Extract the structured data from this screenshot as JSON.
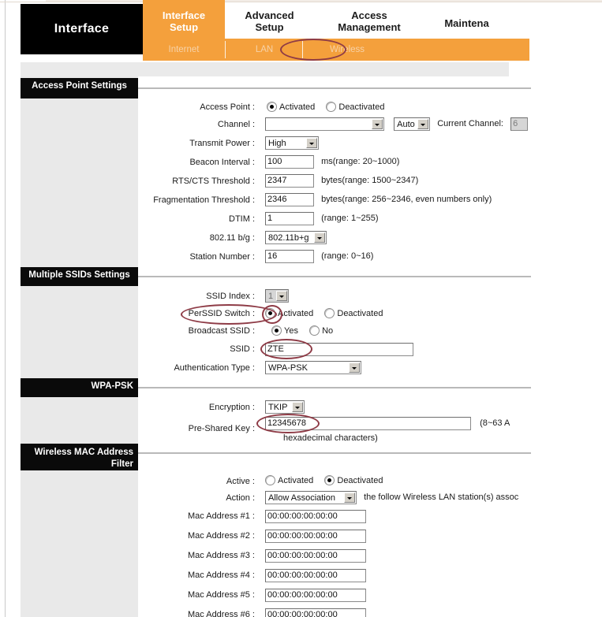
{
  "header": {
    "brand": "Interface",
    "tabs": [
      {
        "name": "interface-setup",
        "line1": "Interface",
        "line2": "Setup",
        "active": true
      },
      {
        "name": "advanced-setup",
        "line1": "Advanced",
        "line2": "Setup",
        "active": false
      },
      {
        "name": "access-management",
        "line1": "Access",
        "line2": "Management",
        "active": false
      },
      {
        "name": "maintenance",
        "line1": "Maintena",
        "line2": "",
        "active": false
      }
    ],
    "subtabs": [
      {
        "name": "internet",
        "label": "Internet"
      },
      {
        "name": "lan",
        "label": "LAN"
      },
      {
        "name": "wireless",
        "label": "Wireless",
        "highlighted": true
      }
    ]
  },
  "sections": {
    "access_point": {
      "title": "Access Point Settings",
      "access_point_label": "Access Point :",
      "access_point_value": "Activated",
      "radio_activated": "Activated",
      "radio_deactivated": "Deactivated",
      "channel_label": "Channel :",
      "channel_value": "",
      "channel_mode": "Auto",
      "current_channel_label": "Current Channel:",
      "current_channel_value": "6",
      "transmit_power_label": "Transmit Power :",
      "transmit_power_value": "High",
      "beacon_interval_label": "Beacon Interval :",
      "beacon_interval_value": "100",
      "beacon_interval_hint": "ms(range: 20~1000)",
      "rts_cts_label": "RTS/CTS Threshold :",
      "rts_cts_value": "2347",
      "rts_cts_hint": "bytes(range: 1500~2347)",
      "fragmentation_label": "Fragmentation Threshold :",
      "fragmentation_value": "2346",
      "fragmentation_hint": "bytes(range: 256~2346, even numbers only)",
      "dtim_label": "DTIM :",
      "dtim_value": "1",
      "dtim_hint": "(range: 1~255)",
      "mode_label": "802.11 b/g :",
      "mode_value": "802.11b+g",
      "station_number_label": "Station Number :",
      "station_number_value": "16",
      "station_number_hint": "(range: 0~16)"
    },
    "multiple_ssids": {
      "title": "Multiple SSIDs Settings",
      "ssid_index_label": "SSID Index :",
      "ssid_index_value": "1",
      "perssid_label": "PerSSID Switch :",
      "perssid_activated": "Activated",
      "perssid_deactivated": "Deactivated",
      "broadcast_label": "Broadcast SSID :",
      "broadcast_yes": "Yes",
      "broadcast_no": "No",
      "ssid_label": "SSID :",
      "ssid_value": "ZTE",
      "auth_type_label": "Authentication Type :",
      "auth_type_value": "WPA-PSK"
    },
    "wpa_psk": {
      "title": "WPA-PSK",
      "encryption_label": "Encryption :",
      "encryption_value": "TKIP",
      "psk_label": "Pre-Shared Key :",
      "psk_value": "12345678",
      "psk_hint_1": "(8~63 A",
      "psk_hint_2": "hexadecimal characters)"
    },
    "mac_filter": {
      "title_line1": "Wireless MAC Address",
      "title_line2": "Filter",
      "active_label": "Active :",
      "active_activated": "Activated",
      "active_deactivated": "Deactivated",
      "action_label": "Action :",
      "action_value": "Allow Association",
      "action_hint": "the follow Wireless LAN station(s) assoc",
      "mac_rows": [
        {
          "label": "Mac Address #1 :",
          "value": "00:00:00:00:00:00"
        },
        {
          "label": "Mac Address #2 :",
          "value": "00:00:00:00:00:00"
        },
        {
          "label": "Mac Address #3 :",
          "value": "00:00:00:00:00:00"
        },
        {
          "label": "Mac Address #4 :",
          "value": "00:00:00:00:00:00"
        },
        {
          "label": "Mac Address #5 :",
          "value": "00:00:00:00:00:00"
        },
        {
          "label": "Mac Address #6 :",
          "value": "00:00:00:00:00:00"
        }
      ]
    }
  },
  "colors": {
    "accent_orange": "#f4a03c",
    "section_black": "#0a0a0a",
    "annotation_red": "#8e3b46",
    "sidebar_gray": "#e9e9e9"
  }
}
